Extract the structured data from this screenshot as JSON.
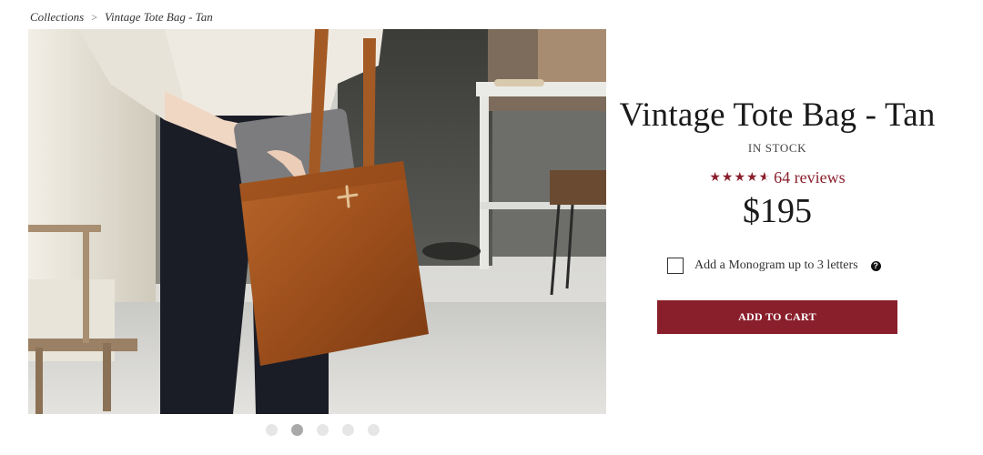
{
  "breadcrumb": {
    "collections": "Collections",
    "separator": ">",
    "current": "Vintage Tote Bag - Tan"
  },
  "product": {
    "title": "Vintage Tote Bag - Tan",
    "stock_status": "IN STOCK",
    "rating": 4.5,
    "rating_max": 5,
    "reviews_label": "64 reviews",
    "price": "$195",
    "monogram_label": "Add a Monogram up to 3 letters",
    "monogram_help_icon": "?",
    "monogram_checked": false,
    "add_to_cart_label": "ADD TO CART"
  },
  "gallery": {
    "slide_count": 5,
    "active_slide": 2
  },
  "colors": {
    "accent": "#8a1f2c",
    "text": "#1a1a1a",
    "dot_inactive": "#e6e6e6",
    "dot_active": "#a9a9a9"
  }
}
